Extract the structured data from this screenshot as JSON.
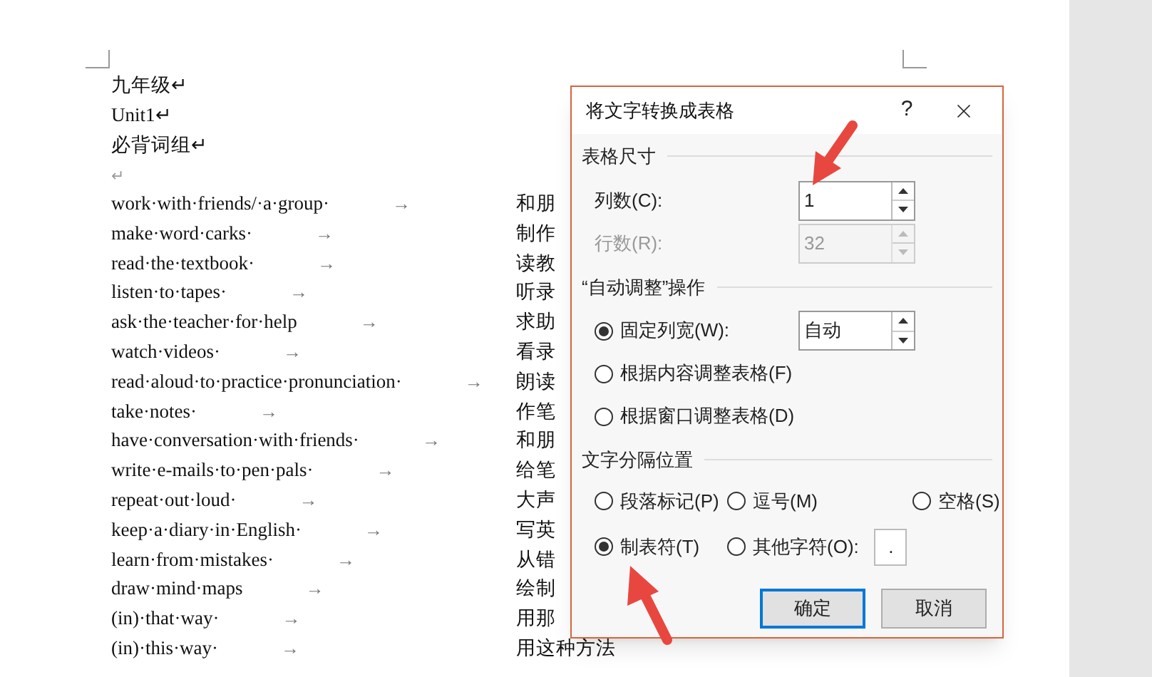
{
  "document": {
    "lines": [
      {
        "kind": "text",
        "text": "九年级↵"
      },
      {
        "kind": "text",
        "text": "Unit1↵"
      },
      {
        "kind": "text",
        "text": "必背词组↵"
      },
      {
        "kind": "mark",
        "text": "↵"
      }
    ],
    "rows": [
      {
        "english": "work·with·friends/·a·group·",
        "arrow": "→",
        "chinese": "和朋"
      },
      {
        "english": "make·word·carks·",
        "arrow": "→",
        "chinese": "制作"
      },
      {
        "english": "read·the·textbook·",
        "arrow": "→",
        "chinese": "读教"
      },
      {
        "english": "listen·to·tapes·",
        "arrow": "→",
        "chinese": "听录"
      },
      {
        "english": "ask·the·teacher·for·help",
        "arrow": "→",
        "chinese": "求助"
      },
      {
        "english": "watch·videos·",
        "arrow": "→",
        "chinese": "看录"
      },
      {
        "english": "read·aloud·to·practice·pronunciation·",
        "arrow": "→",
        "chinese": "朗读"
      },
      {
        "english": "take·notes·",
        "arrow": "→",
        "chinese": "作笔"
      },
      {
        "english": "have·conversation·with·friends·",
        "arrow": "→",
        "chinese": "和朋"
      },
      {
        "english": "write·e-mails·to·pen·pals·",
        "arrow": "→",
        "chinese": "给笔"
      },
      {
        "english": "repeat·out·loud·",
        "arrow": "→",
        "chinese": "大声"
      },
      {
        "english": "keep·a·diary·in·English·",
        "arrow": "→",
        "chinese": "写英"
      },
      {
        "english": "learn·from·mistakes·",
        "arrow": "→",
        "chinese": "从错"
      },
      {
        "english": "draw·mind·maps",
        "arrow": "→",
        "chinese": "绘制"
      },
      {
        "english": "(in)·that·way·",
        "arrow": "→",
        "chinese": "用那"
      },
      {
        "english": "(in)·this·way·",
        "arrow": "→",
        "chinese": "用这种方法"
      }
    ]
  },
  "dialog": {
    "title": "将文字转换成表格",
    "help": "?",
    "size_section": {
      "title": "表格尺寸",
      "fields": [
        {
          "label": "列数(C):",
          "value": "1",
          "disabled": false
        },
        {
          "label": "行数(R):",
          "value": "32",
          "disabled": true
        }
      ]
    },
    "autofit_section": {
      "title": "“自动调整”操作",
      "options": [
        {
          "label": "固定列宽(W):",
          "selected": true,
          "value": "自动"
        },
        {
          "label": "根据内容调整表格(F)",
          "selected": false
        },
        {
          "label": "根据窗口调整表格(D)",
          "selected": false
        }
      ]
    },
    "separator_section": {
      "title": "文字分隔位置",
      "options": [
        {
          "label": "段落标记(P)",
          "selected": false
        },
        {
          "label": "逗号(M)",
          "selected": false
        },
        {
          "label": "空格(S)",
          "selected": false
        },
        {
          "label": "制表符(T)",
          "selected": true
        },
        {
          "label": "其他字符(O):",
          "selected": false,
          "value": "."
        }
      ]
    },
    "buttons": [
      {
        "label": "确定",
        "default": true
      },
      {
        "label": "取消",
        "default": false
      }
    ]
  }
}
